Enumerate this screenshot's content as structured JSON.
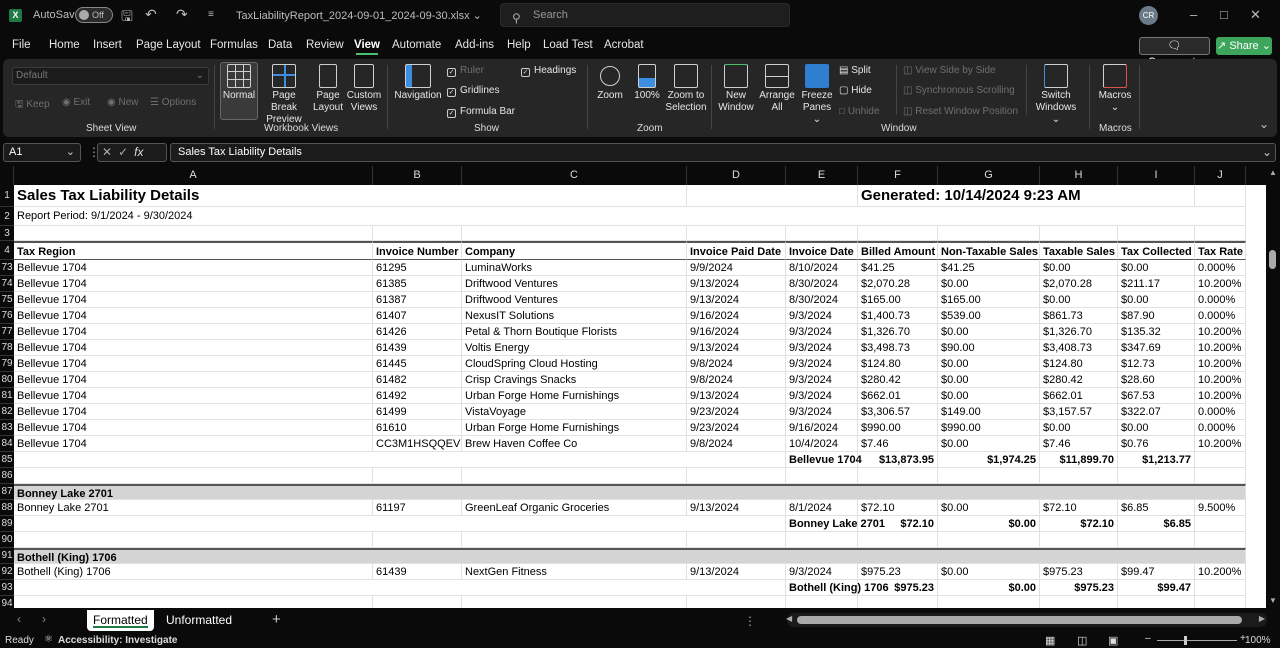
{
  "titlebar": {
    "app_logo": "X",
    "autosave_label": "AutoSave",
    "autosave_state": "Off",
    "filename": "TaxLiabilityReport_2024-09-01_2024-09-30.xlsx",
    "search_placeholder": "Search",
    "user_initials": "CR"
  },
  "menu": {
    "items": [
      "File",
      "Home",
      "Insert",
      "Page Layout",
      "Formulas",
      "Data",
      "Review",
      "View",
      "Automate",
      "Add-ins",
      "Help",
      "Load Test",
      "Acrobat"
    ],
    "active": "View",
    "comments_label": "Comments",
    "share_label": "Share"
  },
  "ribbon": {
    "sheet_view": {
      "dropdown_value": "Default",
      "keep": "Keep",
      "exit": "Exit",
      "new": "New",
      "options": "Options",
      "label": "Sheet View"
    },
    "workbook_views": {
      "normal": "Normal",
      "page_break_1": "Page Break",
      "page_break_2": "Preview",
      "page_layout_1": "Page",
      "page_layout_2": "Layout",
      "custom_1": "Custom",
      "custom_2": "Views",
      "label": "Workbook Views"
    },
    "show": {
      "navigation": "Navigation",
      "ruler": "Ruler",
      "ruler_checked": true,
      "gridlines": "Gridlines",
      "gridlines_checked": true,
      "formula_bar": "Formula Bar",
      "formula_bar_checked": true,
      "headings": "Headings",
      "headings_checked": true,
      "label": "Show"
    },
    "zoom": {
      "zoom": "Zoom",
      "hundred": "100%",
      "zoom_sel_1": "Zoom to",
      "zoom_sel_2": "Selection",
      "label": "Zoom"
    },
    "window": {
      "new_1": "New",
      "new_2": "Window",
      "arrange_1": "Arrange",
      "arrange_2": "All",
      "freeze_1": "Freeze",
      "freeze_2": "Panes",
      "split": "Split",
      "hide": "Hide",
      "unhide": "Unhide",
      "side_by_side": "View Side by Side",
      "sync_scroll": "Synchronous Scrolling",
      "reset_pos": "Reset Window Position",
      "switch_1": "Switch",
      "switch_2": "Windows",
      "label": "Window"
    },
    "macros": {
      "macros": "Macros",
      "label": "Macros"
    }
  },
  "formula_bar": {
    "cell_ref": "A1",
    "fx": "fx",
    "value": "Sales Tax Liability Details"
  },
  "sheet": {
    "columns": [
      "A",
      "B",
      "C",
      "D",
      "E",
      "F",
      "G",
      "H",
      "I",
      "J"
    ],
    "title": "Sales Tax Liability Details",
    "generated": "Generated: 10/14/2024 9:23 AM",
    "period": "Report Period: 9/1/2024 - 9/30/2024",
    "headers": [
      "Tax Region",
      "Invoice Number",
      "Company",
      "Invoice Paid Date",
      "Invoice Date",
      "Billed Amount",
      "Non-Taxable Sales",
      "Taxable Sales",
      "Tax Collected",
      "Tax Rate"
    ],
    "row_numbers": [
      "1",
      "2",
      "3",
      "4",
      "73",
      "74",
      "75",
      "76",
      "77",
      "78",
      "79",
      "80",
      "81",
      "82",
      "83",
      "84",
      "85",
      "86",
      "87",
      "88",
      "89",
      "90",
      "91",
      "92",
      "93",
      "94"
    ],
    "rows": [
      [
        "Bellevue 1704",
        "61295",
        "LuminaWorks",
        "9/9/2024",
        "8/10/2024",
        "$41.25",
        "$41.25",
        "$0.00",
        "$0.00",
        "0.000%"
      ],
      [
        "Bellevue 1704",
        "61385",
        "Driftwood Ventures",
        "9/13/2024",
        "8/30/2024",
        "$2,070.28",
        "$0.00",
        "$2,070.28",
        "$211.17",
        "10.200%"
      ],
      [
        "Bellevue 1704",
        "61387",
        "Driftwood Ventures",
        "9/13/2024",
        "8/30/2024",
        "$165.00",
        "$165.00",
        "$0.00",
        "$0.00",
        "0.000%"
      ],
      [
        "Bellevue 1704",
        "61407",
        "NexusIT Solutions",
        "9/16/2024",
        "9/3/2024",
        "$1,400.73",
        "$539.00",
        "$861.73",
        "$87.90",
        "0.000%"
      ],
      [
        "Bellevue 1704",
        "61426",
        "Petal & Thorn Boutique Florists",
        "9/16/2024",
        "9/3/2024",
        "$1,326.70",
        "$0.00",
        "$1,326.70",
        "$135.32",
        "10.200%"
      ],
      [
        "Bellevue 1704",
        "61439",
        "Voltis Energy",
        "9/13/2024",
        "9/3/2024",
        "$3,498.73",
        "$90.00",
        "$3,408.73",
        "$347.69",
        "10.200%"
      ],
      [
        "Bellevue 1704",
        "61445",
        "CloudSpring Cloud Hosting",
        "9/8/2024",
        "9/3/2024",
        "$124.80",
        "$0.00",
        "$124.80",
        "$12.73",
        "10.200%"
      ],
      [
        "Bellevue 1704",
        "61482",
        "Crisp Cravings Snacks",
        "9/8/2024",
        "9/3/2024",
        "$280.42",
        "$0.00",
        "$280.42",
        "$28.60",
        "10.200%"
      ],
      [
        "Bellevue 1704",
        "61492",
        "Urban Forge Home Furnishings",
        "9/13/2024",
        "9/3/2024",
        "$662.01",
        "$0.00",
        "$662.01",
        "$67.53",
        "10.200%"
      ],
      [
        "Bellevue 1704",
        "61499",
        "VistaVoyage",
        "9/23/2024",
        "9/3/2024",
        "$3,306.57",
        "$149.00",
        "$3,157.57",
        "$322.07",
        "0.000%"
      ],
      [
        "Bellevue 1704",
        "61610",
        "Urban Forge Home Furnishings",
        "9/23/2024",
        "9/16/2024",
        "$990.00",
        "$990.00",
        "$0.00",
        "$0.00",
        "0.000%"
      ],
      [
        "Bellevue 1704",
        "CC3M1HSQQEV",
        "Brew Haven Coffee Co",
        "9/8/2024",
        "10/4/2024",
        "$7.46",
        "$0.00",
        "$7.46",
        "$0.76",
        "10.200%"
      ]
    ],
    "bellevue_total": [
      "Bellevue 1704",
      "$13,873.95",
      "$1,974.25",
      "$11,899.70",
      "$1,213.77"
    ],
    "bonney_group": "Bonney Lake 2701",
    "bonney_row": [
      "Bonney Lake 2701",
      "61197",
      "GreenLeaf Organic Groceries",
      "9/13/2024",
      "8/1/2024",
      "$72.10",
      "$0.00",
      "$72.10",
      "$6.85",
      "9.500%"
    ],
    "bonney_total": [
      "Bonney Lake 2701",
      "$72.10",
      "$0.00",
      "$72.10",
      "$6.85"
    ],
    "bothell_group": "Bothell (King) 1706",
    "bothell_row": [
      "Bothell (King) 1706",
      "61439",
      "NextGen Fitness",
      "9/13/2024",
      "9/3/2024",
      "$975.23",
      "$0.00",
      "$975.23",
      "$99.47",
      "10.200%"
    ],
    "bothell_total": [
      "Bothell (King) 1706",
      "$975.23",
      "$0.00",
      "$975.23",
      "$99.47"
    ]
  },
  "sheet_tabs": {
    "tabs": [
      "Formatted",
      "Unformatted"
    ],
    "active": "Formatted",
    "add": "+"
  },
  "statusbar": {
    "ready": "Ready",
    "accessibility": "Accessibility: Investigate",
    "zoom": "100%"
  }
}
